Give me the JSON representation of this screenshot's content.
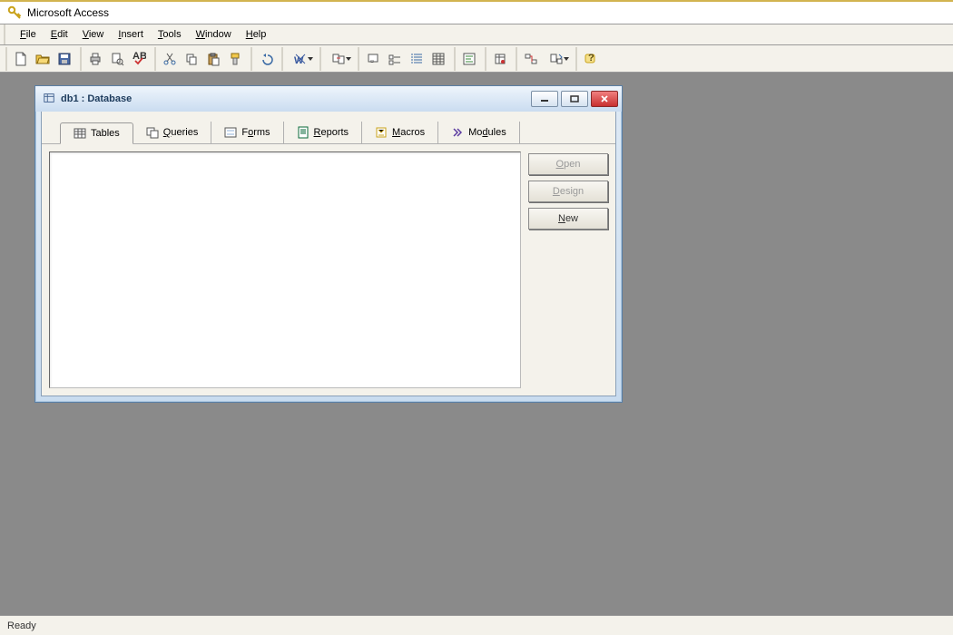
{
  "app": {
    "title": "Microsoft Access"
  },
  "menus": {
    "file": "File",
    "edit": "Edit",
    "view": "View",
    "insert": "Insert",
    "tools": "Tools",
    "window": "Window",
    "help": "Help"
  },
  "child_window": {
    "title": "db1 : Database",
    "tabs": {
      "tables": "Tables",
      "queries": "Queries",
      "forms": "Forms",
      "reports": "Reports",
      "macros": "Macros",
      "modules": "Modules"
    },
    "buttons": {
      "open": "Open",
      "design": "Design",
      "new": "New"
    }
  },
  "status": {
    "text": "Ready"
  },
  "toolbar_icons": {
    "new": "new-file",
    "open": "open-folder",
    "save": "save",
    "print": "print",
    "preview": "print-preview",
    "spell": "spelling",
    "cut": "cut",
    "copy": "copy",
    "paste": "paste",
    "format": "format-painter",
    "undo": "undo",
    "large": "large-icons",
    "small": "small-icons",
    "list": "list-view",
    "details": "details-view",
    "code": "code",
    "props": "properties",
    "rel": "relationships",
    "analyze": "analyze",
    "help": "help"
  }
}
